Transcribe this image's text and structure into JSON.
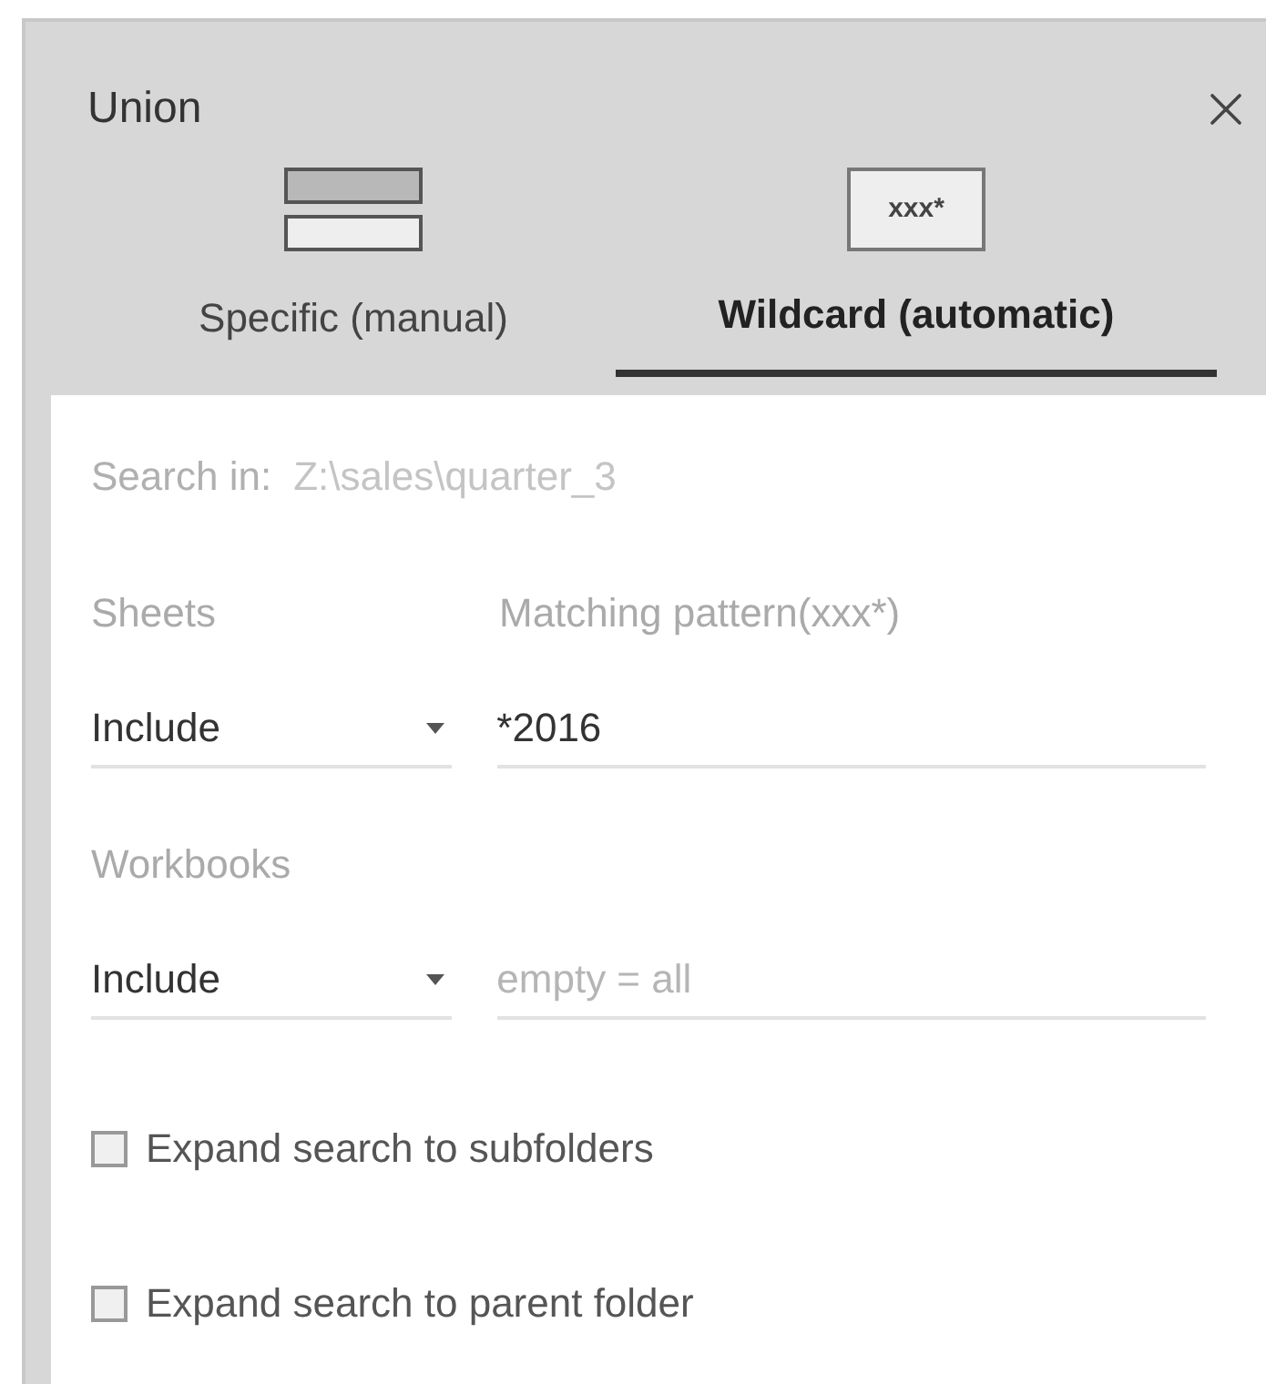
{
  "dialog": {
    "title": "Union"
  },
  "tabs": [
    {
      "label": "Specific (manual)",
      "kind": "manual",
      "selected": false
    },
    {
      "label": "Wildcard (automatic)",
      "kind": "wildcard",
      "icon_text": "xxx*",
      "selected": true
    }
  ],
  "search_in": {
    "label": "Search in:",
    "value": "Z:\\sales\\quarter_3"
  },
  "filters": [
    {
      "label": "Sheets",
      "pattern_label": "Matching pattern(xxx*)",
      "mode": "Include",
      "value": "*2016"
    },
    {
      "label": "Workbooks",
      "mode": "Include",
      "placeholder": "empty = all"
    }
  ],
  "options": [
    {
      "label": "Expand search to subfolders",
      "checked": false
    },
    {
      "label": "Expand search to parent folder",
      "checked": false
    }
  ]
}
